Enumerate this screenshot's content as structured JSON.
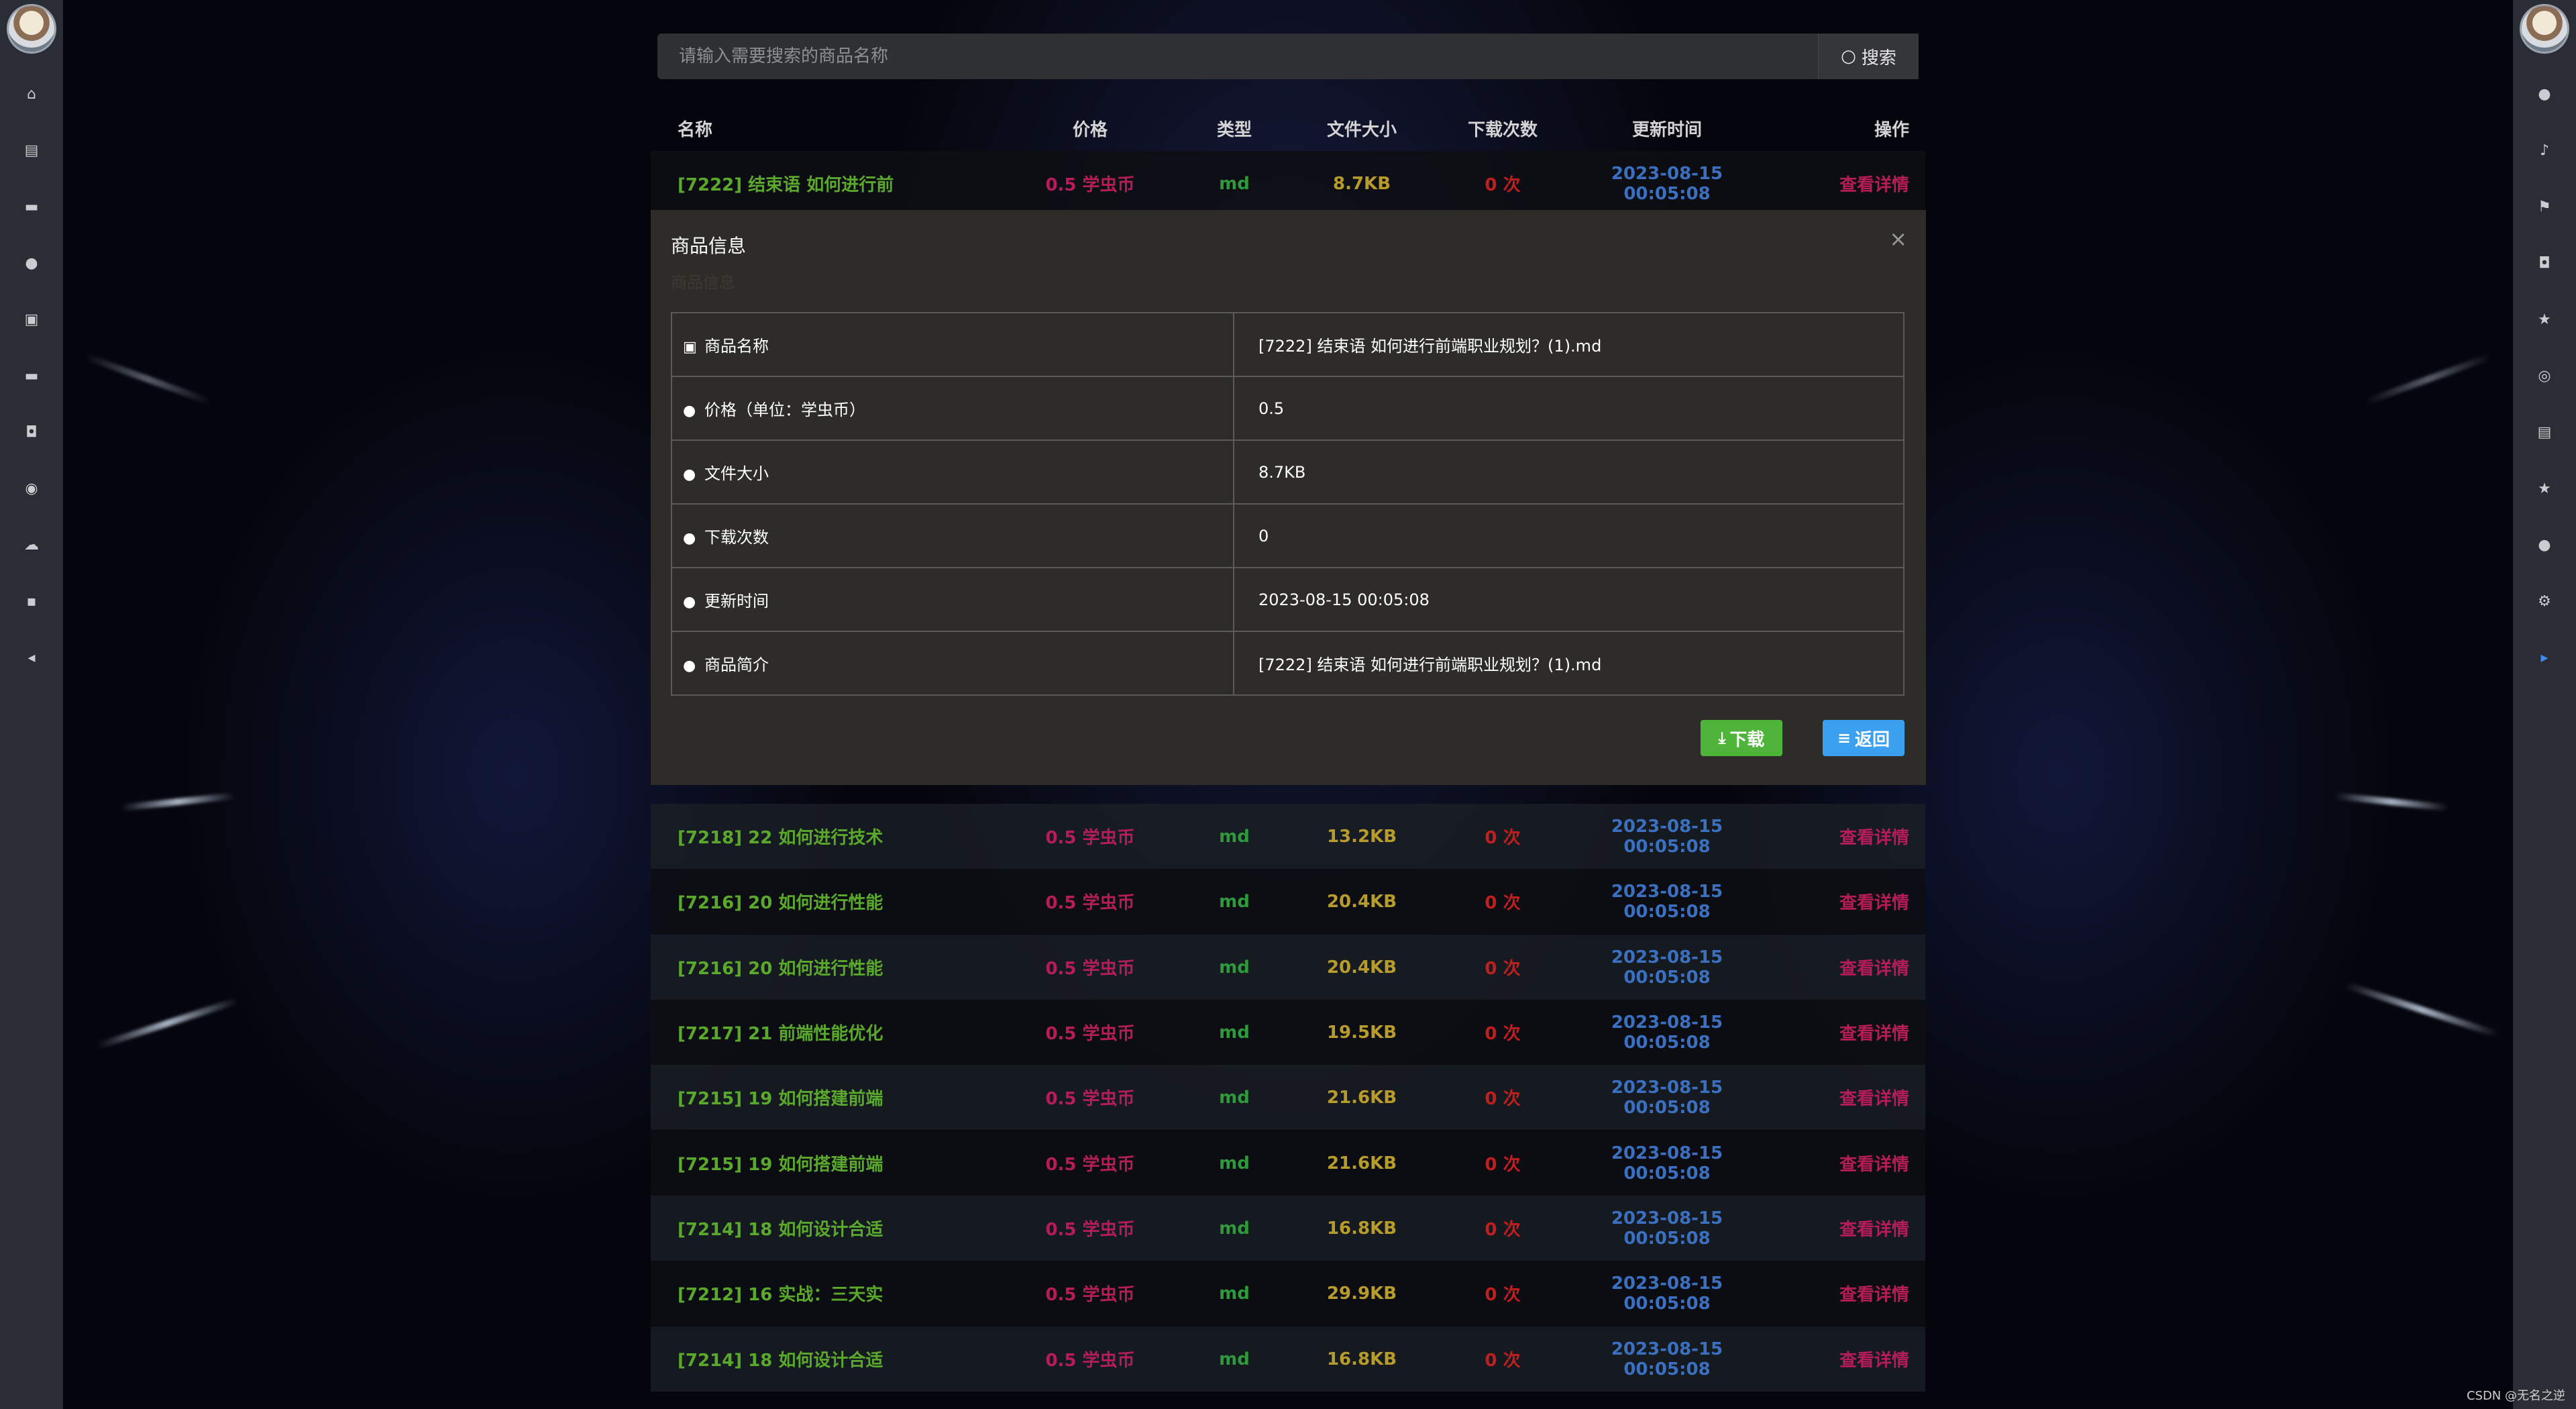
{
  "search": {
    "placeholder": "请输入需要搜索的商品名称",
    "button_label": "搜索"
  },
  "table": {
    "headers": {
      "name": "名称",
      "price": "价格",
      "type": "类型",
      "size": "文件大小",
      "downloads": "下载次数",
      "time": "更新时间",
      "action": "操作"
    },
    "rows": [
      {
        "name": "[7222] 结束语 如何进行前",
        "price": "0.5 学虫币",
        "type": "md",
        "size": "8.7KB",
        "downloads": "0 次",
        "time": "2023-08-15 00:05:08",
        "action": "查看详情"
      },
      {
        "name": "[7218] 22 如何进行技术",
        "price": "0.5 学虫币",
        "type": "md",
        "size": "13.2KB",
        "downloads": "0 次",
        "time": "2023-08-15 00:05:08",
        "action": "查看详情"
      },
      {
        "name": "[7216] 20 如何进行性能",
        "price": "0.5 学虫币",
        "type": "md",
        "size": "20.4KB",
        "downloads": "0 次",
        "time": "2023-08-15 00:05:08",
        "action": "查看详情"
      },
      {
        "name": "[7216] 20 如何进行性能",
        "price": "0.5 学虫币",
        "type": "md",
        "size": "20.4KB",
        "downloads": "0 次",
        "time": "2023-08-15 00:05:08",
        "action": "查看详情"
      },
      {
        "name": "[7217] 21 前端性能优化",
        "price": "0.5 学虫币",
        "type": "md",
        "size": "19.5KB",
        "downloads": "0 次",
        "time": "2023-08-15 00:05:08",
        "action": "查看详情"
      },
      {
        "name": "[7215] 19 如何搭建前端",
        "price": "0.5 学虫币",
        "type": "md",
        "size": "21.6KB",
        "downloads": "0 次",
        "time": "2023-08-15 00:05:08",
        "action": "查看详情"
      },
      {
        "name": "[7215] 19 如何搭建前端",
        "price": "0.5 学虫币",
        "type": "md",
        "size": "21.6KB",
        "downloads": "0 次",
        "time": "2023-08-15 00:05:08",
        "action": "查看详情"
      },
      {
        "name": "[7214] 18 如何设计合适",
        "price": "0.5 学虫币",
        "type": "md",
        "size": "16.8KB",
        "downloads": "0 次",
        "time": "2023-08-15 00:05:08",
        "action": "查看详情"
      },
      {
        "name": "[7212] 16 实战：三天实",
        "price": "0.5 学虫币",
        "type": "md",
        "size": "29.9KB",
        "downloads": "0 次",
        "time": "2023-08-15 00:05:08",
        "action": "查看详情"
      },
      {
        "name": "[7214] 18 如何设计合适",
        "price": "0.5 学虫币",
        "type": "md",
        "size": "16.8KB",
        "downloads": "0 次",
        "time": "2023-08-15 00:05:08",
        "action": "查看详情"
      }
    ]
  },
  "modal": {
    "title": "商品信息",
    "subtitle": "商品信息",
    "close_label": "×",
    "fields": [
      {
        "label": "商品名称",
        "value": "[7222] 结束语  如何进行前端职业规划？(1).md",
        "icon": "image-icon"
      },
      {
        "label": "价格（单位：学虫币）",
        "value": "0.5",
        "icon": "user-icon"
      },
      {
        "label": "文件大小",
        "value": "8.7KB",
        "icon": "user-icon"
      },
      {
        "label": "下载次数",
        "value": "0",
        "icon": "user-icon"
      },
      {
        "label": "更新时间",
        "value": "2023-08-15 00:05:08",
        "icon": "user-icon"
      },
      {
        "label": "商品简介",
        "value": "[7222] 结束语  如何进行前端职业规划？(1).md",
        "icon": "user-icon"
      }
    ],
    "download_label": "下载",
    "back_label": "返回"
  },
  "sidebar_left": {
    "icons": [
      "home-icon",
      "document-icon",
      "monitor-icon",
      "user-icon",
      "clipboard-icon",
      "monitor-icon",
      "car-icon",
      "location-pin-icon",
      "cloud-upload-icon",
      "chat-icon",
      "collapse-left-icon"
    ]
  },
  "sidebar_right": {
    "icons": [
      "user-icon",
      "bell-icon",
      "flag-icon",
      "car-icon",
      "star-icon",
      "life-ring-icon",
      "document-icon",
      "star-icon",
      "user-icon",
      "gear-icon",
      "expand-right-icon"
    ]
  },
  "footer": {
    "text": "CSDN @无名之逆"
  },
  "colors": {
    "name": "#5aa82c",
    "price": "#b61d58",
    "type": "#2e9a3b",
    "size": "#b79c2b",
    "downloads": "#c21e1e",
    "time": "#3b6fc0",
    "download_button": "#4fb53a",
    "back_button": "#3aa0ef"
  }
}
